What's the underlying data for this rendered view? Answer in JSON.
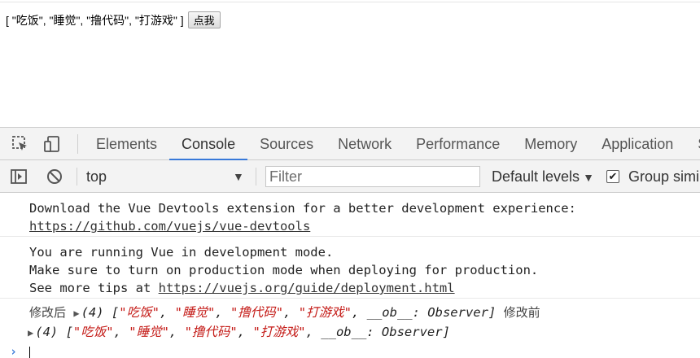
{
  "page": {
    "array_text": "[ \"吃饭\", \"睡觉\", \"撸代码\", \"打游戏\" ]",
    "button_label": "点我"
  },
  "devtools": {
    "tabs": [
      "Elements",
      "Console",
      "Sources",
      "Network",
      "Performance",
      "Memory",
      "Application",
      "Se"
    ],
    "active_tab": "Console",
    "toolbar": {
      "context": "top",
      "filter_placeholder": "Filter",
      "levels": "Default levels",
      "group_similar": "Group simi",
      "group_checked": true
    },
    "console": {
      "msg1": {
        "line1": "Download the Vue Devtools extension for a better development experience:",
        "link": "https://github.com/vuejs/vue-devtools"
      },
      "msg2": {
        "line1": "You are running Vue in development mode.",
        "line2": "Make sure to turn on production mode when deploying for production.",
        "prefix": "See more tips at ",
        "link": "https://vuejs.org/guide/deployment.html"
      },
      "log1": {
        "prefix": "修改后",
        "count": "(4)",
        "items": [
          "\"吃饭\"",
          "\"睡觉\"",
          "\"撸代码\"",
          "\"打游戏\""
        ],
        "ob": "__ob__: Observer",
        "suffix": "修改前"
      },
      "log2": {
        "count": "(4)",
        "items": [
          "\"吃饭\"",
          "\"睡觉\"",
          "\"撸代码\"",
          "\"打游戏\""
        ],
        "ob": "__ob__: Observer"
      }
    }
  },
  "colors": {
    "accent": "#3879d9",
    "string": "#c41a16",
    "toolbar_bg": "#f3f3f3"
  }
}
